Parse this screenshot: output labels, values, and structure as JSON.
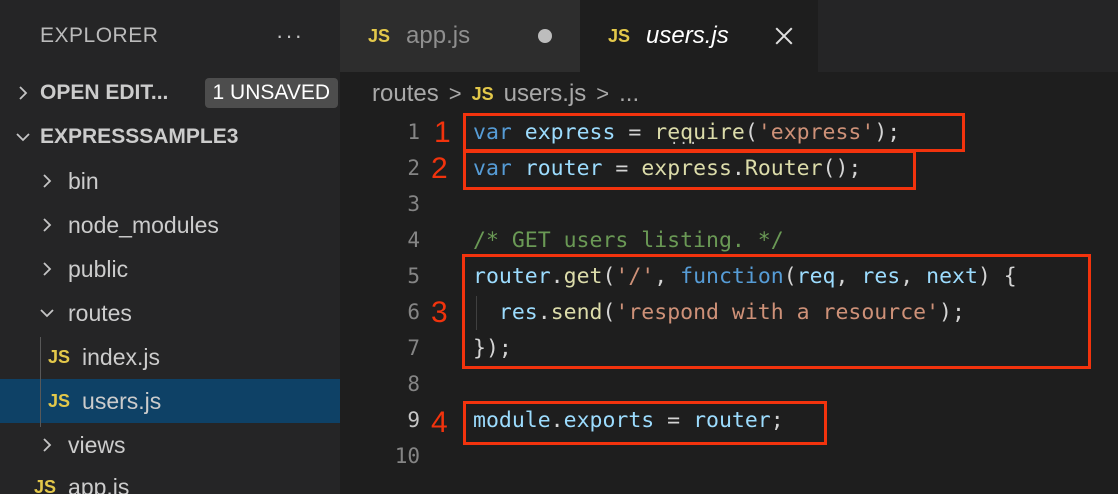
{
  "sidebar": {
    "title": "EXPLORER",
    "more": "···",
    "open_editors": {
      "label": "OPEN EDIT...",
      "badge": "1 UNSAVED"
    },
    "project": {
      "label": "EXPRESSSAMPLE3"
    },
    "items": [
      {
        "label": "bin"
      },
      {
        "label": "node_modules"
      },
      {
        "label": "public"
      },
      {
        "label": "routes"
      },
      {
        "label": "index.js",
        "tag": "JS"
      },
      {
        "label": "users.js",
        "tag": "JS"
      },
      {
        "label": "views"
      },
      {
        "label": "app.js",
        "tag": "JS"
      }
    ]
  },
  "tabs": [
    {
      "tag": "JS",
      "label": "app.js",
      "unsaved": true
    },
    {
      "tag": "JS",
      "label": "users.js",
      "active": true
    }
  ],
  "breadcrumb": {
    "folder": "routes",
    "tag": "JS",
    "file": "users.js",
    "ellipsis": "..."
  },
  "code": {
    "line_numbers": [
      "1",
      "2",
      "3",
      "4",
      "5",
      "6",
      "7",
      "8",
      "9",
      "10"
    ],
    "tokens": {
      "l1": [
        "var",
        " ",
        "express",
        " = ",
        "require",
        "(",
        "'express'",
        ");"
      ],
      "l2": [
        "var",
        " ",
        "router",
        " = ",
        "express",
        ".",
        "Router",
        "();"
      ],
      "l4": [
        "/* GET users listing. */"
      ],
      "l5": [
        "router",
        ".",
        "get",
        "(",
        "'/'",
        ", ",
        "function",
        "(",
        "req",
        ", ",
        "res",
        ", ",
        "next",
        ") {"
      ],
      "l6": [
        "  ",
        "res",
        ".",
        "send",
        "(",
        "'respond with a resource'",
        ");"
      ],
      "l7": [
        "});"
      ],
      "l9": [
        "module",
        ".",
        "exports",
        " = ",
        "router",
        ";"
      ]
    }
  },
  "annotations": [
    "1",
    "2",
    "3",
    "4"
  ],
  "colors": {
    "highlight": "#f2330d",
    "keyword": "#569cd6",
    "variable": "#9cdcfe",
    "function": "#dcdcaa",
    "string": "#ce9178",
    "comment": "#6a9955",
    "js_icon": "#e3c84a",
    "selection": "#0e4166"
  }
}
